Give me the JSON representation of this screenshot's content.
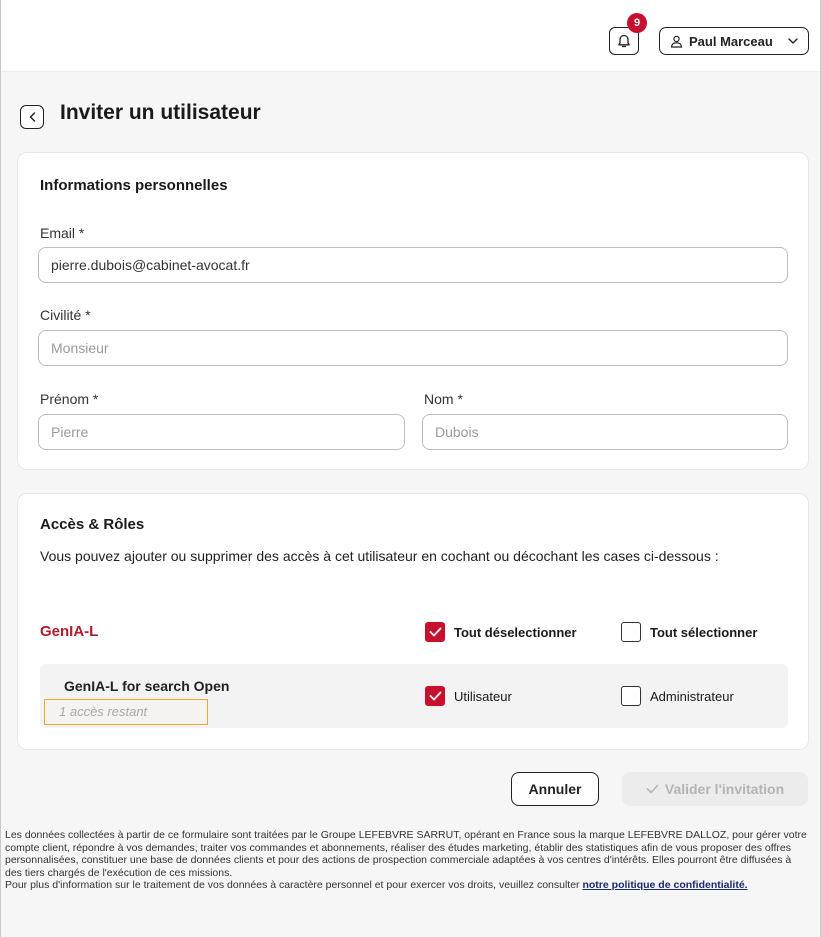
{
  "header": {
    "notifications_count": "9",
    "user_name": "Paul Marceau"
  },
  "page": {
    "title": "Inviter un utilisateur"
  },
  "personal": {
    "section_title": "Informations personnelles",
    "email_label": "Email *",
    "email_value": "pierre.dubois@cabinet-avocat.fr",
    "civilite_label": "Civilité *",
    "civilite_placeholder": "Monsieur",
    "prenom_label": "Prénom *",
    "prenom_placeholder": "Pierre",
    "nom_label": "Nom *",
    "nom_placeholder": "Dubois"
  },
  "access": {
    "section_title": "Accès & Rôles",
    "description": "Vous pouvez ajouter ou supprimer des accès à cet utilisateur en cochant ou décochant les cases ci-dessous :",
    "brand": "GenIA-L",
    "deselect_all_label": "Tout déselectionner",
    "select_all_label": "Tout sélectionner",
    "deselect_all_checked": true,
    "select_all_checked": false,
    "product": {
      "name": "GenIA-L for search Open",
      "remaining": "1 accès restant",
      "role_user_label": "Utilisateur",
      "role_admin_label": "Administrateur",
      "role_user_checked": true,
      "role_admin_checked": false
    }
  },
  "actions": {
    "cancel_label": "Annuler",
    "validate_label": "Valider l'invitation"
  },
  "legal": {
    "text": "Les données collectées à partir de ce formulaire sont traitées par le Groupe LEFEBVRE SARRUT, opérant en France sous la marque LEFEBVRE DALLOZ, pour gérer votre compte client, répondre à vos demandes, traiter vos commandes et abonnements, réaliser des études marketing, établir des statistiques afin de vous proposer des offres personnalisées, constituer une base de données clients et pour des actions de prospection commerciale adaptées à vos centres d'intérêts. Elles pourront être diffusées à des tiers chargés de l'exécution de ces missions.",
    "text2": "Pour plus d'information sur le traitement de vos données à caractère personnel et pour exercer vos droits, veuillez consulter ",
    "link_label": "notre politique de confidentialité."
  },
  "colors": {
    "accent_red": "#c8102e",
    "warning_orange": "#f0a43a"
  }
}
